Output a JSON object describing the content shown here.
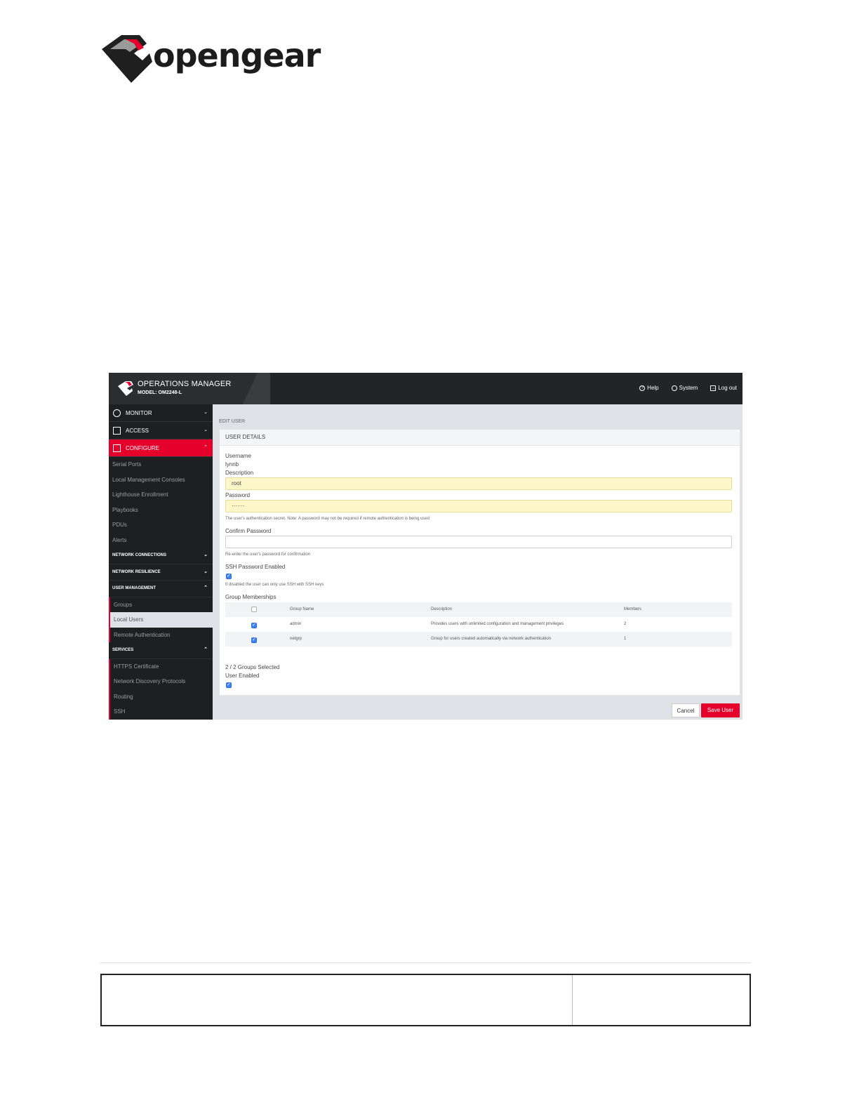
{
  "brand": {
    "logo_text": "opengear"
  },
  "app": {
    "title": "OPERATIONS MANAGER",
    "model": "MODEL: OM2248-L",
    "header_links": {
      "help": "Help",
      "system": "System",
      "logout": "Log out"
    }
  },
  "sidebar": {
    "monitor": "MONITOR",
    "access": "ACCESS",
    "configure": "CONFIGURE",
    "configure_items": [
      "Serial Ports",
      "Local Management Consoles",
      "Lighthouse Enrollment",
      "Playbooks",
      "PDUs",
      "Alerts"
    ],
    "network_connections": "NETWORK CONNECTIONS",
    "network_resilience": "NETWORK RESILIENCE",
    "user_management": "USER MANAGEMENT",
    "user_management_items": [
      "Groups",
      "Local Users",
      "Remote Authentication"
    ],
    "services": "SERVICES",
    "services_items": [
      "HTTPS Certificate",
      "Network Discovery Protocols",
      "Routing",
      "SSH"
    ]
  },
  "page": {
    "breadcrumb": "EDIT USER",
    "panel_title": "USER DETAILS",
    "username_label": "Username",
    "username_value": "lynnb",
    "description_label": "Description",
    "description_value": "root",
    "password_label": "Password",
    "password_value": "·······",
    "password_hint": "The user's authentication secret. Note: A password may not be required if remote authentication is being used",
    "confirm_label": "Confirm Password",
    "confirm_value": "",
    "confirm_hint": "Re-enter the user's password for confirmation",
    "ssh_label": "SSH Password Enabled",
    "ssh_hint": "If disabled the user can only use SSH with SSH keys",
    "groups_label": "Group Memberships",
    "groups_table": {
      "headers": [
        "Group Name",
        "Description",
        "Members"
      ],
      "rows": [
        {
          "name": "admin",
          "description": "Provides users with unlimited configuration and management privileges",
          "members": "2"
        },
        {
          "name": "netgrp",
          "description": "Group for users created automatically via network authentication",
          "members": "1"
        }
      ]
    },
    "groups_selected": "2 / 2 Groups Selected",
    "user_enabled_label": "User Enabled"
  },
  "actions": {
    "cancel": "Cancel",
    "save": "Save User"
  },
  "colors": {
    "accent": "#e4002b",
    "topbar": "#2b2d30",
    "sidebar": "#1e1f21",
    "autofill": "#fdf6c8",
    "checkbox": "#3b82f6"
  }
}
